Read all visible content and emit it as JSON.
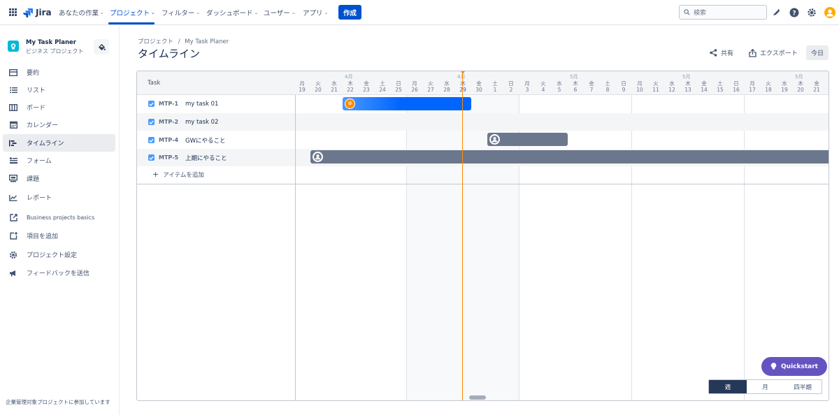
{
  "topnav": {
    "logo": "Jira",
    "items": [
      {
        "label": "あなたの作業"
      },
      {
        "label": "プロジェクト"
      },
      {
        "label": "フィルター"
      },
      {
        "label": "ダッシュボード"
      },
      {
        "label": "ユーザー"
      },
      {
        "label": "アプリ"
      }
    ],
    "create_label": "作成",
    "search_placeholder": "検索"
  },
  "sidebar": {
    "project_name": "My Task Planer",
    "project_type": "ビジネス プロジェクト",
    "items": [
      {
        "label": "要約",
        "icon": "summary-icon"
      },
      {
        "label": "リスト",
        "icon": "list-icon"
      },
      {
        "label": "ボード",
        "icon": "board-icon"
      },
      {
        "label": "カレンダー",
        "icon": "calendar-icon"
      },
      {
        "label": "タイムライン",
        "icon": "timeline-icon"
      },
      {
        "label": "フォーム",
        "icon": "form-icon"
      },
      {
        "label": "課題",
        "icon": "issues-icon"
      },
      {
        "label": "レポート",
        "icon": "report-icon"
      },
      {
        "label": "Business projects basics",
        "icon": "external-link-icon"
      },
      {
        "label": "項目を追加",
        "icon": "add-item-icon"
      },
      {
        "label": "プロジェクト設定",
        "icon": "gear-icon"
      },
      {
        "label": "フィードバックを送信",
        "icon": "megaphone-icon"
      }
    ],
    "footer": "企業管理対象プロジェクトに参加しています"
  },
  "header": {
    "breadcrumb_project": "プロジェクト",
    "breadcrumb_sep": "/",
    "breadcrumb_name": "My Task Planer",
    "title": "タイムライン",
    "share_label": "共有",
    "export_label": "エクスポート",
    "today_label": "今日"
  },
  "timeline": {
    "task_header": "Task",
    "months": [
      "4月",
      "4月",
      "5月",
      "5月",
      "5月"
    ],
    "days": [
      {
        "w": "月",
        "d": "19"
      },
      {
        "w": "火",
        "d": "20"
      },
      {
        "w": "水",
        "d": "21"
      },
      {
        "w": "木",
        "d": "22"
      },
      {
        "w": "金",
        "d": "23"
      },
      {
        "w": "土",
        "d": "24"
      },
      {
        "w": "日",
        "d": "25"
      },
      {
        "w": "月",
        "d": "26"
      },
      {
        "w": "火",
        "d": "27"
      },
      {
        "w": "水",
        "d": "28"
      },
      {
        "w": "木",
        "d": "29"
      },
      {
        "w": "金",
        "d": "30"
      },
      {
        "w": "土",
        "d": "1"
      },
      {
        "w": "日",
        "d": "2"
      },
      {
        "w": "月",
        "d": "3"
      },
      {
        "w": "火",
        "d": "4"
      },
      {
        "w": "水",
        "d": "5"
      },
      {
        "w": "木",
        "d": "6"
      },
      {
        "w": "金",
        "d": "7"
      },
      {
        "w": "土",
        "d": "8"
      },
      {
        "w": "日",
        "d": "9"
      },
      {
        "w": "月",
        "d": "10"
      },
      {
        "w": "火",
        "d": "11"
      },
      {
        "w": "水",
        "d": "12"
      },
      {
        "w": "木",
        "d": "13"
      },
      {
        "w": "金",
        "d": "14"
      },
      {
        "w": "土",
        "d": "15"
      },
      {
        "w": "日",
        "d": "16"
      },
      {
        "w": "月",
        "d": "17"
      },
      {
        "w": "火",
        "d": "18"
      },
      {
        "w": "水",
        "d": "19"
      },
      {
        "w": "木",
        "d": "20"
      },
      {
        "w": "金",
        "d": "21"
      }
    ],
    "tasks": [
      {
        "key": "MTP-1",
        "summary": "my task 01",
        "avatar": "U"
      },
      {
        "key": "MTP-2",
        "summary": "my task 02"
      },
      {
        "key": "MTP-4",
        "summary": "GWにやること"
      },
      {
        "key": "MTP-5",
        "summary": "上期にやること"
      }
    ],
    "add_item_label": "アイテムを追加",
    "zoom": [
      "週",
      "月",
      "四半期"
    ]
  },
  "quickstart_label": "Quickstart",
  "colors": {
    "brand": "#0052cc",
    "bar_blue": "#0065ff",
    "bar_gray": "#6b778c",
    "today_line": "#ff8b00",
    "quickstart": "#6554c0"
  }
}
